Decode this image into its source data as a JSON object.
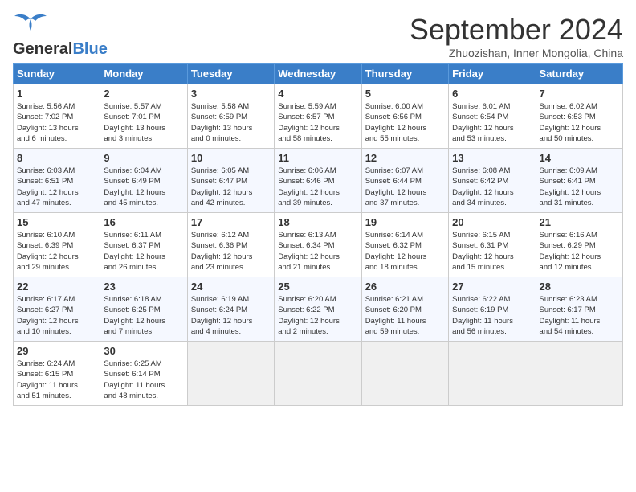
{
  "header": {
    "logo_general": "General",
    "logo_blue": "Blue",
    "month_year": "September 2024",
    "location": "Zhuozishan, Inner Mongolia, China"
  },
  "weekdays": [
    "Sunday",
    "Monday",
    "Tuesday",
    "Wednesday",
    "Thursday",
    "Friday",
    "Saturday"
  ],
  "weeks": [
    [
      {
        "day": "1",
        "info": "Sunrise: 5:56 AM\nSunset: 7:02 PM\nDaylight: 13 hours\nand 6 minutes."
      },
      {
        "day": "2",
        "info": "Sunrise: 5:57 AM\nSunset: 7:01 PM\nDaylight: 13 hours\nand 3 minutes."
      },
      {
        "day": "3",
        "info": "Sunrise: 5:58 AM\nSunset: 6:59 PM\nDaylight: 13 hours\nand 0 minutes."
      },
      {
        "day": "4",
        "info": "Sunrise: 5:59 AM\nSunset: 6:57 PM\nDaylight: 12 hours\nand 58 minutes."
      },
      {
        "day": "5",
        "info": "Sunrise: 6:00 AM\nSunset: 6:56 PM\nDaylight: 12 hours\nand 55 minutes."
      },
      {
        "day": "6",
        "info": "Sunrise: 6:01 AM\nSunset: 6:54 PM\nDaylight: 12 hours\nand 53 minutes."
      },
      {
        "day": "7",
        "info": "Sunrise: 6:02 AM\nSunset: 6:53 PM\nDaylight: 12 hours\nand 50 minutes."
      }
    ],
    [
      {
        "day": "8",
        "info": "Sunrise: 6:03 AM\nSunset: 6:51 PM\nDaylight: 12 hours\nand 47 minutes."
      },
      {
        "day": "9",
        "info": "Sunrise: 6:04 AM\nSunset: 6:49 PM\nDaylight: 12 hours\nand 45 minutes."
      },
      {
        "day": "10",
        "info": "Sunrise: 6:05 AM\nSunset: 6:47 PM\nDaylight: 12 hours\nand 42 minutes."
      },
      {
        "day": "11",
        "info": "Sunrise: 6:06 AM\nSunset: 6:46 PM\nDaylight: 12 hours\nand 39 minutes."
      },
      {
        "day": "12",
        "info": "Sunrise: 6:07 AM\nSunset: 6:44 PM\nDaylight: 12 hours\nand 37 minutes."
      },
      {
        "day": "13",
        "info": "Sunrise: 6:08 AM\nSunset: 6:42 PM\nDaylight: 12 hours\nand 34 minutes."
      },
      {
        "day": "14",
        "info": "Sunrise: 6:09 AM\nSunset: 6:41 PM\nDaylight: 12 hours\nand 31 minutes."
      }
    ],
    [
      {
        "day": "15",
        "info": "Sunrise: 6:10 AM\nSunset: 6:39 PM\nDaylight: 12 hours\nand 29 minutes."
      },
      {
        "day": "16",
        "info": "Sunrise: 6:11 AM\nSunset: 6:37 PM\nDaylight: 12 hours\nand 26 minutes."
      },
      {
        "day": "17",
        "info": "Sunrise: 6:12 AM\nSunset: 6:36 PM\nDaylight: 12 hours\nand 23 minutes."
      },
      {
        "day": "18",
        "info": "Sunrise: 6:13 AM\nSunset: 6:34 PM\nDaylight: 12 hours\nand 21 minutes."
      },
      {
        "day": "19",
        "info": "Sunrise: 6:14 AM\nSunset: 6:32 PM\nDaylight: 12 hours\nand 18 minutes."
      },
      {
        "day": "20",
        "info": "Sunrise: 6:15 AM\nSunset: 6:31 PM\nDaylight: 12 hours\nand 15 minutes."
      },
      {
        "day": "21",
        "info": "Sunrise: 6:16 AM\nSunset: 6:29 PM\nDaylight: 12 hours\nand 12 minutes."
      }
    ],
    [
      {
        "day": "22",
        "info": "Sunrise: 6:17 AM\nSunset: 6:27 PM\nDaylight: 12 hours\nand 10 minutes."
      },
      {
        "day": "23",
        "info": "Sunrise: 6:18 AM\nSunset: 6:25 PM\nDaylight: 12 hours\nand 7 minutes."
      },
      {
        "day": "24",
        "info": "Sunrise: 6:19 AM\nSunset: 6:24 PM\nDaylight: 12 hours\nand 4 minutes."
      },
      {
        "day": "25",
        "info": "Sunrise: 6:20 AM\nSunset: 6:22 PM\nDaylight: 12 hours\nand 2 minutes."
      },
      {
        "day": "26",
        "info": "Sunrise: 6:21 AM\nSunset: 6:20 PM\nDaylight: 11 hours\nand 59 minutes."
      },
      {
        "day": "27",
        "info": "Sunrise: 6:22 AM\nSunset: 6:19 PM\nDaylight: 11 hours\nand 56 minutes."
      },
      {
        "day": "28",
        "info": "Sunrise: 6:23 AM\nSunset: 6:17 PM\nDaylight: 11 hours\nand 54 minutes."
      }
    ],
    [
      {
        "day": "29",
        "info": "Sunrise: 6:24 AM\nSunset: 6:15 PM\nDaylight: 11 hours\nand 51 minutes."
      },
      {
        "day": "30",
        "info": "Sunrise: 6:25 AM\nSunset: 6:14 PM\nDaylight: 11 hours\nand 48 minutes."
      },
      {
        "day": "",
        "info": ""
      },
      {
        "day": "",
        "info": ""
      },
      {
        "day": "",
        "info": ""
      },
      {
        "day": "",
        "info": ""
      },
      {
        "day": "",
        "info": ""
      }
    ]
  ]
}
